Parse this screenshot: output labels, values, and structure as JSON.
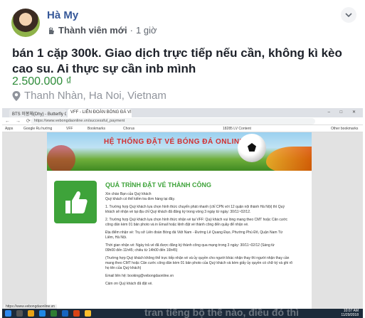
{
  "post": {
    "author": "Hà My",
    "badge": "Thành viên mới",
    "separator": "·",
    "time": "1 giờ",
    "text": "bán 1 cặp 300k. Giao dịch trực tiếp nếu cần, không kì kèo cao su. Ai thực sự cần inb mình",
    "price": "2.500.000 ₫",
    "location": "Thanh Nhàn, Ha Noi, Vietnam"
  },
  "browser": {
    "tabs": [
      {
        "label": "BTS 미봉체(Dhy) - Butterfly Co..."
      },
      {
        "label": "VFF - LIÊN ĐOÀN BÓNG ĐÁ VIỆ..."
      }
    ],
    "url": "https://www.vebongdaonline.vn/successful_payment",
    "bookmarks": [
      "Apps",
      "Google Ru hướng",
      "VFF",
      "Bookmarks",
      "Chorus",
      "18285 LV Content",
      "Other bookmarks"
    ],
    "banner_title": "HỆ THỐNG ĐẶT VÉ BÓNG ĐÁ ONLINE",
    "content_title": "QUÁ TRÌNH ĐẶT VÉ THÀNH CÔNG",
    "content_lines": [
      "Xin chào Bạn của Quý khách",
      "Quý khách có thể kiểm tra đơn hàng tại đây.",
      "1. Trường hợp Quý khách lựa chọn hình thức chuyển phát nhanh (chỉ CPN với 12 quận nội thành Hà Nội) thì Quý",
      "khách sẽ nhận vé tại địa chỉ Quý khách đã đăng ký trong vòng 3 ngày từ ngày: 30/11~02/12.",
      "2. Trường hợp Quý khách lựa chọn hình thức nhận vé tại VFF: Quý khách vui lòng mang theo CMT hoặc Căn cước",
      "công dân kèm 01 bản photo và in Email hoặc lệnh đặt vé thành công đến quầy để nhận vé.",
      "Địa điểm nhận vé: Trụ sở Liên đoàn Bóng đá Việt Nam - Đường Lê Quang Đạo, Phường Phú Đô, Quận Nam Từ",
      "Liêm, Hà Nội.",
      "Thời gian nhận vé: Ngày trả vé đã được đăng ký thành công qua mạng trong 3 ngày: 30/11~02/12 (Sáng từ",
      "09h00 đến 11h45; chiều từ 14h00 đến 16h45)",
      "(Trường hợp Quý khách không thể trực tiếp nhận vé và ủy quyền cho người khác nhận thay thì người nhận thay cần",
      "mang theo CMT hoặc Căn cước công dân kèm 01 bản photo của Quý khách và kèm giấy ủy quyền có chữ ký và ghi rõ",
      "họ tên của Quý khách)",
      "Email liên hệ: booking@vebongdaonline.vn",
      "Cảm ơn Quý khách đã đặt vé."
    ],
    "status_url": "https://www.vebongdaonline.vn",
    "clock_time": "10:07 AM",
    "clock_date": "11/29/2018",
    "overlay_text": "tran tiếng bộ thể nào, điều đó thì"
  },
  "colors": {
    "author": "#365899",
    "price": "#2e8c39",
    "success_green": "#3ea33a"
  }
}
